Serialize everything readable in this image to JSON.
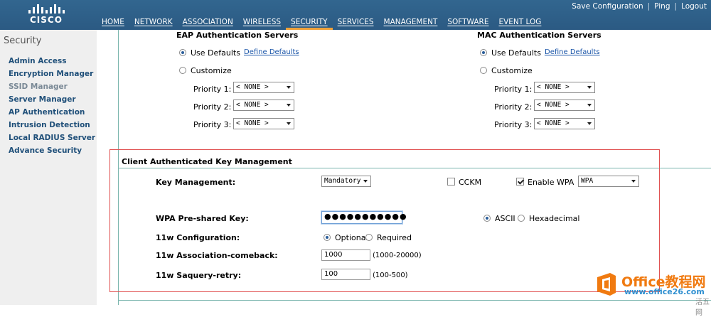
{
  "header": {
    "logo_text": "CISCO",
    "top_links": [
      "Save Configuration",
      "Ping",
      "Logout"
    ],
    "tabs": [
      {
        "label": "HOME",
        "active": false
      },
      {
        "label": "NETWORK",
        "active": false
      },
      {
        "label": "ASSOCIATION",
        "active": false
      },
      {
        "label": "WIRELESS",
        "active": false
      },
      {
        "label": "SECURITY",
        "active": true
      },
      {
        "label": "SERVICES",
        "active": false
      },
      {
        "label": "MANAGEMENT",
        "active": false
      },
      {
        "label": "SOFTWARE",
        "active": false
      },
      {
        "label": "EVENT LOG",
        "active": false
      }
    ],
    "active_tab_color": "#f0a23a",
    "bar_color": "#2e5f8a"
  },
  "sidebar": {
    "title": "Security",
    "items": [
      {
        "label": "Admin Access",
        "active": false
      },
      {
        "label": "Encryption Manager",
        "active": false
      },
      {
        "label": "SSID Manager",
        "active": true
      },
      {
        "label": "Server Manager",
        "active": false
      },
      {
        "label": "AP Authentication",
        "active": false
      },
      {
        "label": "Intrusion Detection",
        "active": false
      },
      {
        "label": "Local RADIUS Server",
        "active": false
      },
      {
        "label": "Advance Security",
        "active": false
      }
    ]
  },
  "eap": {
    "title": "EAP Authentication Servers",
    "use_defaults_label": "Use Defaults",
    "define_defaults_link": "Define Defaults",
    "customize_label": "Customize",
    "priorities": [
      {
        "label": "Priority 1:",
        "value": "< NONE >"
      },
      {
        "label": "Priority 2:",
        "value": "< NONE >"
      },
      {
        "label": "Priority 3:",
        "value": "< NONE >"
      }
    ]
  },
  "mac": {
    "title": "MAC Authentication Servers",
    "use_defaults_label": "Use Defaults",
    "define_defaults_link": "Define Defaults",
    "customize_label": "Customize",
    "priorities": [
      {
        "label": "Priority 1:",
        "value": "< NONE >"
      },
      {
        "label": "Priority 2:",
        "value": "< NONE >"
      },
      {
        "label": "Priority 3:",
        "value": "< NONE >"
      }
    ]
  },
  "ckm": {
    "title": "Client Authenticated Key Management",
    "key_mgmt_label": "Key Management:",
    "key_mgmt_value": "Mandatory",
    "cckm_label": "CCKM",
    "cckm_checked": false,
    "enable_wpa_label": "Enable WPA",
    "enable_wpa_checked": true,
    "wpa_value": "WPA",
    "psk_label": "WPA Pre-shared Key:",
    "psk_value": "●●●●●●●●●●●",
    "ascii_label": "ASCII",
    "hex_label": "Hexadecimal",
    "w11_config_label": "11w Configuration:",
    "optional_label": "Optional",
    "required_label": "Required",
    "comeback_label": "11w Association-comeback:",
    "comeback_value": "1000",
    "comeback_range": "(1000-20000)",
    "retry_label": "11w Saquery-retry:",
    "retry_value": "100",
    "retry_range": "(100-500)"
  },
  "highlight_color": "#e05050",
  "watermark": {
    "title": "Office教程网",
    "url": "www.office26.com",
    "corner": "活五网"
  }
}
